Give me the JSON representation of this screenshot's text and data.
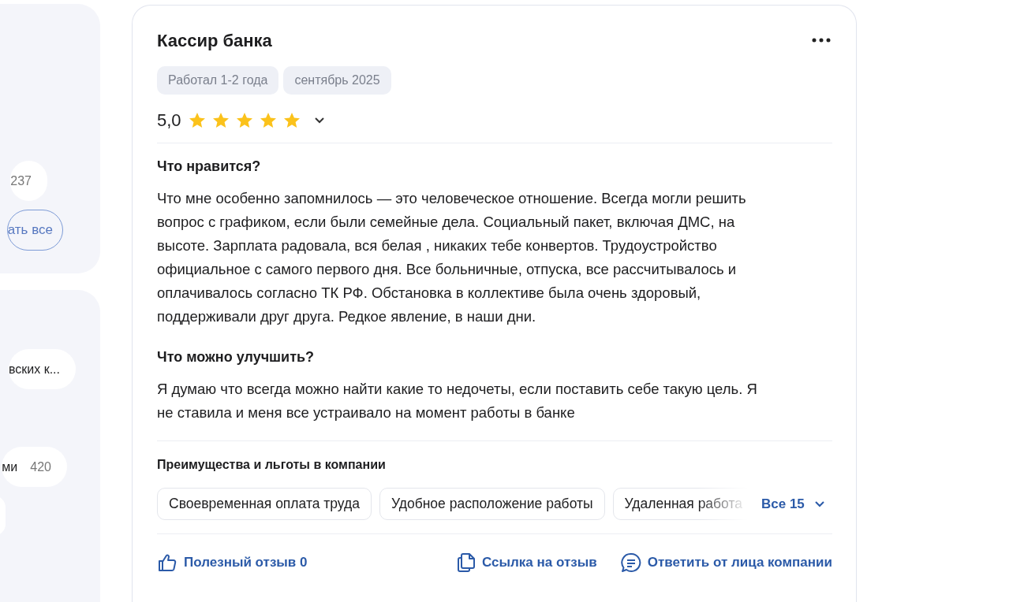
{
  "sidebar": {
    "panels": [
      {
        "pills": [
          {
            "count": "237"
          }
        ],
        "button": "ать все"
      },
      {
        "pills": [
          {
            "label": "вских к..."
          },
          {
            "label": "ми",
            "count": "420"
          }
        ],
        "more_below": true
      }
    ]
  },
  "review": {
    "title": "Кассир банка",
    "tags": [
      "Работал 1-2 года",
      "сентябрь 2025"
    ],
    "rating": "5,0",
    "stars": 5,
    "sections": [
      {
        "heading": "Что нравится?",
        "text": "Что мне особенно запомнилось — это человеческое отношение. Всегда могли решить\nвопрос с графиком, если были семейные дела. Социальный пакет, включая ДМС, на\nвысоте. Зарплата радовала, вся белая , никаких тебе конвертов. Трудоустройство\nофициальное с самого первого дня. Все больничные, отпуска, все рассчитывалось и\nоплачивалось согласно ТК РФ. Обстановка в коллективе была очень здоровый,\nподдерживали друг друга. Редкое явление, в наши дни."
      },
      {
        "heading": "Что можно улучшить?",
        "text": "Я думаю что всегда можно найти какие то недочеты, если поставить себе такую цель. Я\nне ставила и меня все устраивало на момент работы в банке"
      }
    ],
    "benefits": {
      "heading": "Преимущества и льготы в компании",
      "items": [
        "Своевременная оплата труда",
        "Удобное расположение работы",
        "Удаленная работа"
      ],
      "more": "Все 15"
    },
    "actions": [
      {
        "kind": "like",
        "label": "Полезный отзыв 0"
      },
      {
        "kind": "link",
        "label": "Ссылка на отзыв"
      },
      {
        "kind": "reply",
        "label": "Ответить от лица компании"
      }
    ]
  }
}
